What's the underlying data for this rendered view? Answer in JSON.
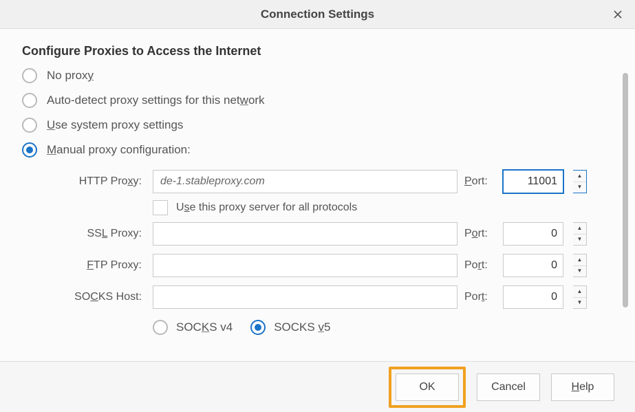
{
  "titlebar": {
    "title": "Connection Settings"
  },
  "heading": "Configure Proxies to Access the Internet",
  "proxy_mode": {
    "no_proxy": {
      "label_pre": "No prox",
      "label_ul": "y",
      "label_post": "",
      "selected": false
    },
    "auto_detect": {
      "label_pre": "Auto-detect proxy settings for this net",
      "label_ul": "w",
      "label_post": "ork",
      "selected": false
    },
    "system": {
      "label_pre": "",
      "label_ul": "U",
      "label_post": "se system proxy settings",
      "selected": false
    },
    "manual": {
      "label_pre": "",
      "label_ul": "M",
      "label_post": "anual proxy configuration:",
      "selected": true
    }
  },
  "http": {
    "label_pre": "HTTP Pro",
    "label_ul": "x",
    "label_post": "y:",
    "host": "de-1.stableproxy.com",
    "port_label_pre": "",
    "port_label_ul": "P",
    "port_label_post": "ort:",
    "port": "11001"
  },
  "use_for_all": {
    "label_pre": "U",
    "label_ul": "s",
    "label_post": "e this proxy server for all protocols",
    "checked": false
  },
  "ssl": {
    "label_pre": "SS",
    "label_ul": "L",
    "label_post": " Proxy:",
    "host": "",
    "port_label_pre": "P",
    "port_label_ul": "o",
    "port_label_post": "rt:",
    "port": "0"
  },
  "ftp": {
    "label_pre": "",
    "label_ul": "F",
    "label_post": "TP Proxy:",
    "host": "",
    "port_label_pre": "Po",
    "port_label_ul": "r",
    "port_label_post": "t:",
    "port": "0"
  },
  "socks": {
    "label_pre": "SO",
    "label_ul": "C",
    "label_post": "KS Host:",
    "host": "",
    "port_label_pre": "Por",
    "port_label_ul": "t",
    "port_label_post": ":",
    "port": "0"
  },
  "socks_version": {
    "v4": {
      "label_pre": "SOC",
      "label_ul": "K",
      "label_post": "S v4",
      "selected": false
    },
    "v5": {
      "label_pre": "SOCKS ",
      "label_ul": "v",
      "label_post": "5",
      "selected": true
    }
  },
  "buttons": {
    "ok": "OK",
    "cancel": "Cancel",
    "help_pre": "",
    "help_ul": "H",
    "help_post": "elp"
  }
}
